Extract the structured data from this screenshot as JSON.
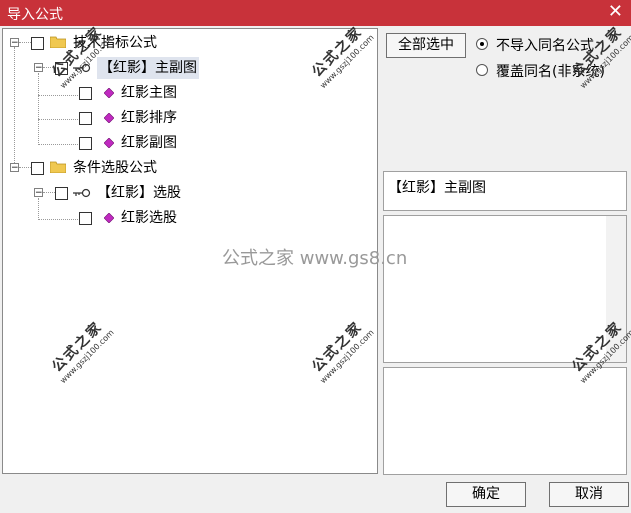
{
  "window": {
    "title": "导入公式"
  },
  "tree": {
    "groups": [
      {
        "label": "技术指标公式",
        "sub": {
          "label": "【红影】主副图",
          "items": [
            "红影主图",
            "红影排序",
            "红影副图"
          ]
        }
      },
      {
        "label": "条件选股公式",
        "sub": {
          "label": "【红影】选股",
          "items": [
            "红影选股"
          ]
        }
      }
    ]
  },
  "controls": {
    "select_all": "全部选中",
    "radio_skip": "不导入同名公式",
    "radio_overwrite": "覆盖同名(非系统)",
    "selected_radio": "skip"
  },
  "info": {
    "name": "【红影】主副图"
  },
  "buttons": {
    "ok": "确定",
    "cancel": "取消"
  },
  "watermark": {
    "name": "公式之家",
    "url": "www.gszj100.com",
    "center": "公式之家 www.gs8.cn"
  }
}
